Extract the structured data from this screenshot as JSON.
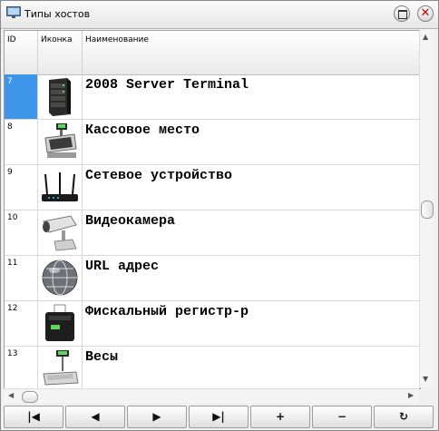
{
  "window": {
    "title": "Типы хостов",
    "restore_icon": "restore-icon",
    "close_icon": "close-icon"
  },
  "columns": {
    "id": "ID",
    "icon": "Иконка",
    "name": "Наименование"
  },
  "rows": [
    {
      "id": "7",
      "icon": "server-icon",
      "name": "2008 Server Terminal",
      "selected": true
    },
    {
      "id": "8",
      "icon": "cash-register-icon",
      "name": "Кассовое место",
      "selected": false
    },
    {
      "id": "9",
      "icon": "router-icon",
      "name": "Сетевое устройство",
      "selected": false
    },
    {
      "id": "10",
      "icon": "camera-icon",
      "name": "Видеокамера",
      "selected": false
    },
    {
      "id": "11",
      "icon": "globe-icon",
      "name": "URL адрес",
      "selected": false
    },
    {
      "id": "12",
      "icon": "fiscal-printer-icon",
      "name": "Фискальный регистр-р",
      "selected": false
    },
    {
      "id": "13",
      "icon": "scales-icon",
      "name": "Весы",
      "selected": false
    }
  ],
  "nav": {
    "first": "|◀",
    "prev": "◀",
    "next": "▶",
    "last": "▶|",
    "add": "+",
    "delete": "−",
    "refresh": "↻"
  },
  "colors": {
    "selection": "#3f95ea"
  }
}
